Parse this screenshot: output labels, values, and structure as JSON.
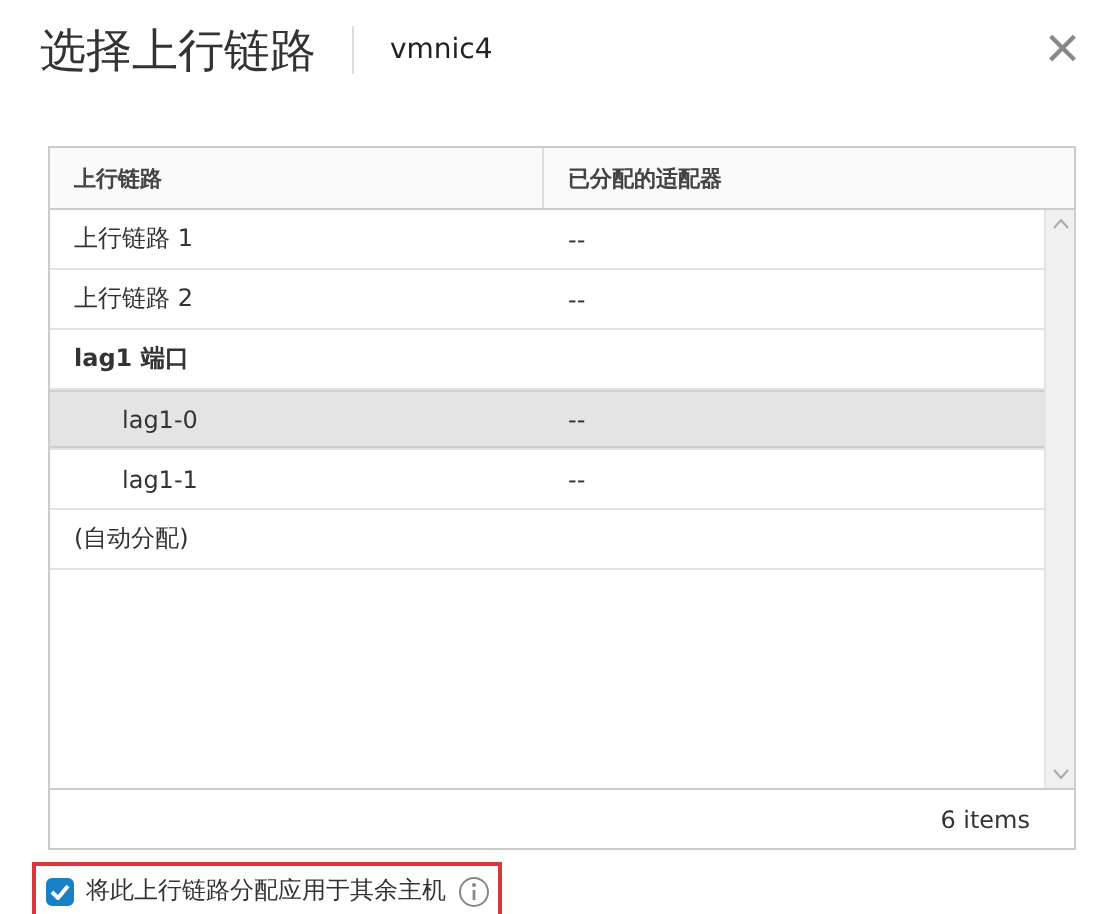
{
  "dialog": {
    "title": "选择上行链路",
    "subtitle": "vmnic4",
    "close": "×"
  },
  "table": {
    "columns": [
      "上行链路",
      "已分配的适配器"
    ],
    "rows": [
      {
        "uplink": "上行链路 1",
        "adapter": "--",
        "selected": false
      },
      {
        "uplink": "上行链路 2",
        "adapter": "--",
        "selected": false
      },
      {
        "uplink": "lag1 端口",
        "selected": false,
        "children": [
          {
            "uplink": "lag1-0",
            "adapter": "--",
            "selected": true
          },
          {
            "uplink": "lag1-1",
            "adapter": "--",
            "selected": false
          }
        ]
      },
      {
        "uplink": "(自动分配)",
        "selected": false
      }
    ],
    "footer": "6 items"
  },
  "apply_to_other_hosts": {
    "label": "将此上行链路分配应用于其余主机",
    "checked": true,
    "highlighted": true
  }
}
